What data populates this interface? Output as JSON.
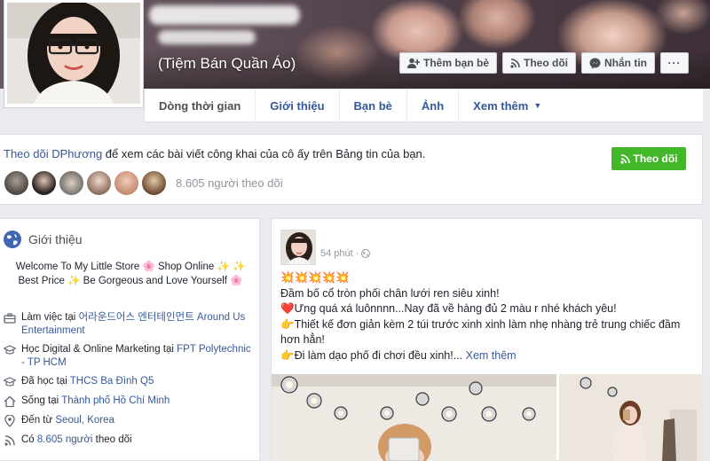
{
  "profile": {
    "subtitle": "(Tiệm Bán Quần Áo)"
  },
  "cover_buttons": {
    "add_friend": "Thêm bạn bè",
    "follow": "Theo dõi",
    "message": "Nhắn tin",
    "more": "···"
  },
  "tabs": [
    {
      "label": "Dòng thời gian"
    },
    {
      "label": "Giới thiệu"
    },
    {
      "label": "Bạn bè"
    },
    {
      "label": "Ảnh"
    },
    {
      "label": "Xem thêm"
    }
  ],
  "follow_card": {
    "prefix": "Theo dõi ",
    "name": "DPhương",
    "suffix": " để xem các bài viết công khai của cô ấy trên Bảng tin của bạn.",
    "button": "Theo dõi",
    "count": "8.605 người theo dõi"
  },
  "intro": {
    "title": "Giới thiệu",
    "bio_line1": "Welcome To My Little Store 🌸 Shop Online ✨ ✨",
    "bio_line2": "Best Price ✨ Be Gorgeous and Love Yourself 🌸",
    "work_prefix": "Làm việc tại ",
    "work_link": "어라운드어스 엔터테인먼트 Around Us Entertainment",
    "study_prefix": "Học Digital & Online Marketing tại ",
    "study_link": "FPT Polytechnic - TP HCM",
    "school_prefix": "Đã học tại ",
    "school_link": "THCS Ba Đình Q5",
    "live_prefix": "Sống tại ",
    "live_link": "Thành phố Hồ Chí Minh",
    "from_prefix": "Đến từ ",
    "from_link": "Seoul, Korea",
    "followed_prefix": "Có ",
    "followed_link": "8.605 người",
    "followed_suffix": " theo dõi"
  },
  "post": {
    "time": "54 phút ·",
    "emojis": "💥💥💥💥💥",
    "line1": "Đầm bố cổ tròn phối chân lưới ren siêu xinh!",
    "line2": "❤️Ưng quá xá luônnnn...Nay đã về hàng đủ 2 màu r nhé khách yêu!",
    "line3": "👉Thiết kế đơn giản kèm 2 túi trước xinh xinh làm nhẹ nhàng trẻ trung chiếc đầm hơn hẳn!",
    "line4": "👉Đi làm dạo phố đi chơi đều xinh!...",
    "see_more": "Xem thêm"
  },
  "colors": {
    "link": "#365899",
    "green": "#42b72a",
    "page_bg": "#e9ebee"
  }
}
